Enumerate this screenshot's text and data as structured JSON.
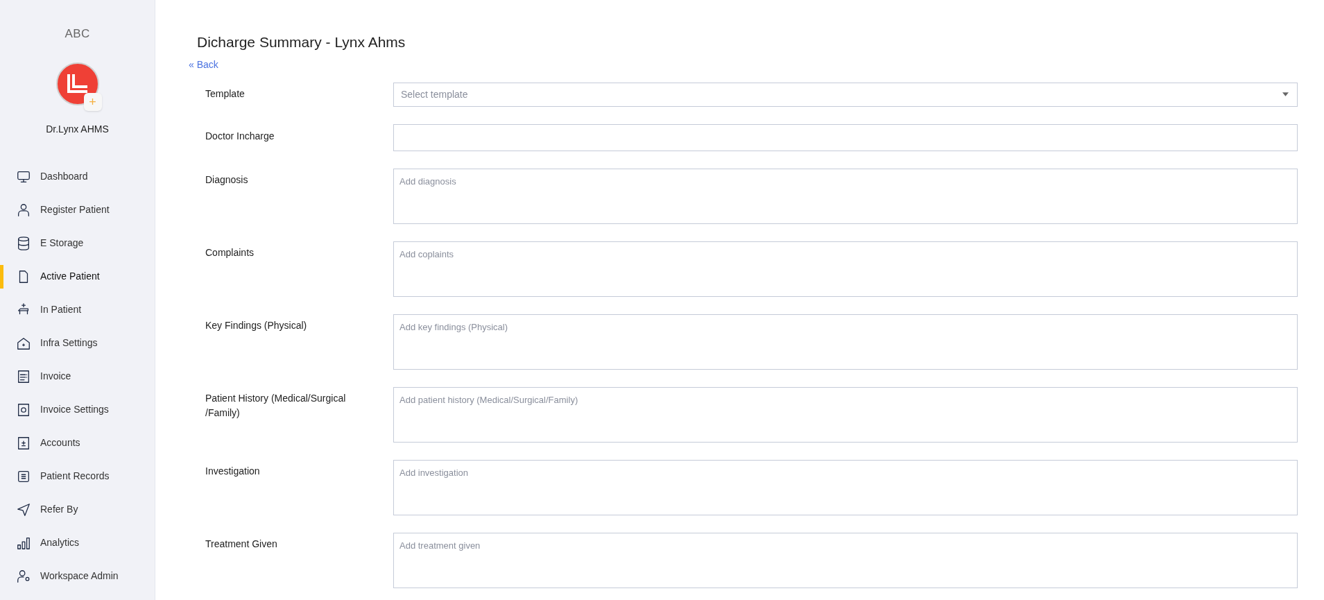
{
  "sidebar": {
    "brand": "ABC",
    "user_name": "Dr.Lynx AHMS",
    "add_button": "+",
    "items": [
      {
        "label": "Dashboard",
        "selected": false
      },
      {
        "label": "Register Patient",
        "selected": false
      },
      {
        "label": "E Storage",
        "selected": false
      },
      {
        "label": "Active Patient",
        "selected": true
      },
      {
        "label": "In Patient",
        "selected": false
      },
      {
        "label": "Infra Settings",
        "selected": false
      },
      {
        "label": "Invoice",
        "selected": false
      },
      {
        "label": "Invoice Settings",
        "selected": false
      },
      {
        "label": "Accounts",
        "selected": false
      },
      {
        "label": "Patient Records",
        "selected": false
      },
      {
        "label": "Refer By",
        "selected": false
      },
      {
        "label": "Analytics",
        "selected": false
      },
      {
        "label": "Workspace Admin",
        "selected": false
      }
    ]
  },
  "page": {
    "title": "Dicharge Summary - Lynx Ahms",
    "back_link": "« Back"
  },
  "form": {
    "fields": [
      {
        "kind": "select",
        "label": "Template",
        "placeholder": "Select template"
      },
      {
        "kind": "input",
        "label": "Doctor Incharge"
      },
      {
        "kind": "textarea",
        "label": "Diagnosis",
        "placeholder": "Add diagnosis"
      },
      {
        "kind": "textarea",
        "label": "Complaints",
        "placeholder": "Add coplaints"
      },
      {
        "kind": "textarea",
        "label": "Key Findings (Physical)",
        "placeholder": "Add key findings (Physical)"
      },
      {
        "kind": "textarea",
        "label": "Patient History (Medical/Surgical /Family)",
        "placeholder": "Add patient history (Medical/Surgical/Family)"
      },
      {
        "kind": "textarea",
        "label": "Investigation",
        "placeholder": "Add investigation"
      },
      {
        "kind": "textarea",
        "label": "Treatment Given",
        "placeholder": "Add treatment given"
      }
    ]
  }
}
